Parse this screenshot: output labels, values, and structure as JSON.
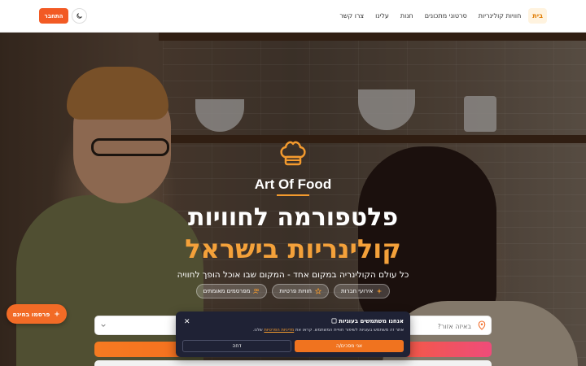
{
  "nav": {
    "links": [
      {
        "label": "בית",
        "active": true
      },
      {
        "label": "חוויות קולינריות",
        "active": false
      },
      {
        "label": "סרטוני מתכונים",
        "active": false
      },
      {
        "label": "חנות",
        "active": false
      },
      {
        "label": "עלינו",
        "active": false
      },
      {
        "label": "צרו קשר",
        "active": false
      }
    ],
    "theme_icon": "moon-icon",
    "login_label": "התחבר"
  },
  "hero": {
    "brand": "Art Of Food",
    "headline_line1": "פלטפורמה לחוויות",
    "headline_line2": "קולינריות בישראל",
    "subtitle": "כל עולם הקולינריה במקום אחד - המקום שבו אוכל הופך לחוויה",
    "chips": [
      {
        "label": "אירועי חברות",
        "icon": "sparkles-icon"
      },
      {
        "label": "חוויות פרטיות",
        "icon": "star-icon"
      },
      {
        "label": "מפרסמים מאומתים",
        "icon": "users-icon"
      }
    ],
    "search": {
      "placeholder": "באיזה אזור?"
    }
  },
  "post_button": {
    "label": "פרסמו בחינם",
    "icon": "plus-icon"
  },
  "cookie_banner": {
    "title": "אנחנו משתמשים בעוגיות",
    "text_before": "אתר זה משתמש בעוגיות לשיפור חוויית המשתמש. קראו את ",
    "link": "מדיניות הפרטיות",
    "text_after": " שלנו.",
    "accept_label": "אני מסכים/ה",
    "reject_label": "דחה"
  },
  "colors": {
    "accent": "#f26b26",
    "headline_highlight": "#f4a13a",
    "active_nav_bg": "#fff3df",
    "cookie_bg": "#1f2235"
  }
}
